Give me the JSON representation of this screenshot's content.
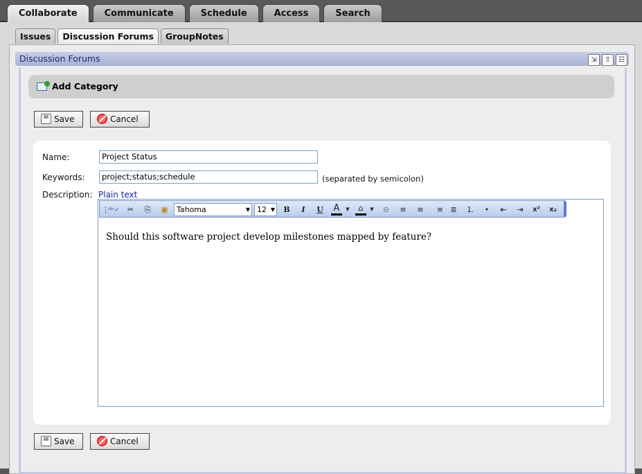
{
  "top_tabs": [
    "Collaborate",
    "Communicate",
    "Schedule",
    "Access",
    "Search"
  ],
  "sub_tabs": [
    "Issues",
    "Discussion Forums",
    "GroupNotes"
  ],
  "panel": {
    "title": "Discussion Forums"
  },
  "category": {
    "title": "Add Category"
  },
  "buttons": {
    "save": "Save",
    "cancel": "Cancel"
  },
  "form": {
    "name_label": "Name:",
    "name_value": "Project Status",
    "keywords_label": "Keywords:",
    "keywords_value": "project;status;schedule",
    "keywords_hint": "(separated by semicolon)",
    "description_label": "Description:",
    "plain_text_link": "Plain text"
  },
  "editor": {
    "font": "Tahoma",
    "size": "12",
    "content": "Should this software project develop milestones mapped by feature?"
  },
  "toolbar_glyphs": {
    "spell": "ᴬᴮᶜ✓",
    "cut": "✂",
    "copy": "⎘",
    "paste": "📋",
    "bold": "B",
    "italic": "I",
    "underline": "U",
    "forecolor": "A",
    "backcolor": "⌂",
    "link": "⊖",
    "left": "≡",
    "center": "≡",
    "right": "≡",
    "justify": "≣",
    "ol": "⒈",
    "ul": "•",
    "outdent": "⇤",
    "indent": "⇥",
    "sup": "x²",
    "sub": "x₂"
  }
}
